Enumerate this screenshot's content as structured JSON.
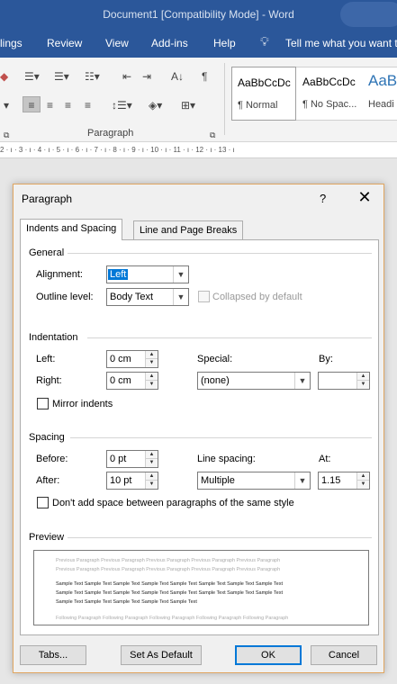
{
  "window": {
    "title": "Document1 [Compatibility Mode]  -  Word"
  },
  "menu": {
    "items": [
      "lings",
      "Review",
      "View",
      "Add-ins",
      "Help"
    ],
    "tellme": "Tell me what you want t"
  },
  "ribbon": {
    "paragraph_group": "Paragraph",
    "styles": [
      {
        "sample": "AaBbCcDc",
        "name": "¶ Normal"
      },
      {
        "sample": "AaBbCcDc",
        "name": "¶ No Spac..."
      },
      {
        "sample": "AaB",
        "name": "Headi"
      }
    ],
    "ruler": "2 · ı · 3 · ı · 4 · ı · 5 · ı · 6 · ı · 7 · ı · 8 · ı · 9 · ı · 10 · ı · 11 · ı · 12 · ı · 13 · ı"
  },
  "dialog": {
    "title": "Paragraph",
    "help": "?",
    "close": "✕",
    "tabs": [
      "Indents and Spacing",
      "Line and Page Breaks"
    ],
    "general": {
      "heading": "General",
      "alignment_label": "Alignment:",
      "alignment_value": "Left",
      "outline_label": "Outline level:",
      "outline_value": "Body Text",
      "collapsed_label": "Collapsed by default"
    },
    "indentation": {
      "heading": "Indentation",
      "left_label": "Left:",
      "left_value": "0 cm",
      "right_label": "Right:",
      "right_value": "0 cm",
      "special_label": "Special:",
      "special_value": "(none)",
      "by_label": "By:",
      "by_value": "",
      "mirror_label": "Mirror indents"
    },
    "spacing": {
      "heading": "Spacing",
      "before_label": "Before:",
      "before_value": "0 pt",
      "after_label": "After:",
      "after_value": "10 pt",
      "line_spacing_label": "Line spacing:",
      "line_spacing_value": "Multiple",
      "at_label": "At:",
      "at_value": "1.15",
      "dont_add_label": "Don't add space between paragraphs of the same style"
    },
    "preview": {
      "heading": "Preview",
      "previous": [
        "Previous Paragraph Previous Paragraph Previous Paragraph Previous Paragraph Previous Paragraph",
        "Previous Paragraph Previous Paragraph Previous Paragraph Previous Paragraph Previous Paragraph"
      ],
      "sample": [
        "Sample Text Sample Text Sample Text Sample Text Sample Text Sample Text Sample Text Sample Text",
        "Sample Text Sample Text Sample Text Sample Text Sample Text Sample Text Sample Text Sample Text",
        "Sample Text Sample Text Sample Text Sample Text Sample Text"
      ],
      "following": [
        "Following Paragraph Following Paragraph Following Paragraph Following Paragraph Following Paragraph"
      ]
    },
    "buttons": {
      "tabs": "Tabs...",
      "set_default": "Set As Default",
      "ok": "OK",
      "cancel": "Cancel"
    }
  }
}
